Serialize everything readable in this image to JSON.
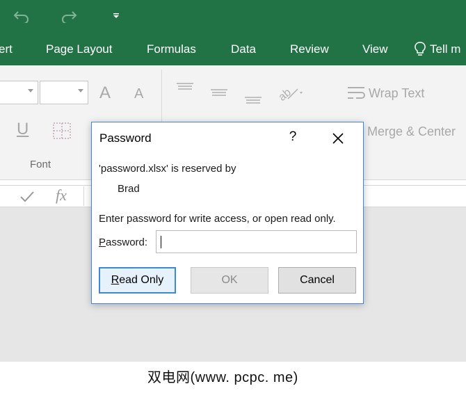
{
  "colors": {
    "excel_green": "#217346",
    "dialog_border": "#3f87d4",
    "sheet_gray": "#e6e6e6"
  },
  "quick_access": {
    "icons": [
      "undo-icon",
      "redo-icon",
      "customize-qat-icon"
    ]
  },
  "ribbon_tabs": [
    {
      "label": "ert"
    },
    {
      "label": "Page Layout"
    },
    {
      "label": "Formulas"
    },
    {
      "label": "Data"
    },
    {
      "label": "Review"
    },
    {
      "label": "View"
    }
  ],
  "tell_me": {
    "label": "Tell m",
    "icon": "lightbulb-icon"
  },
  "ribbon": {
    "increase_font_glyph": "A",
    "decrease_font_glyph": "A",
    "underline_glyph": "U",
    "font_group_label": "Font",
    "wrap_text_label": "Wrap Text",
    "merge_center_label": "Merge & Center"
  },
  "formula_bar": {
    "fx_label": "fx"
  },
  "dialog": {
    "title": "Password",
    "help_label": "?",
    "reserved_line": "'password.xlsx' is reserved by",
    "reserved_by": "Brad",
    "instruction": "Enter password for write access, or open read only.",
    "password_label_mnemonic": "P",
    "password_label_rest": "assword:",
    "password_value": "",
    "read_only_mnemonic": "R",
    "read_only_rest": "ead Only",
    "ok_label": "OK",
    "cancel_label": "Cancel"
  },
  "watermark": "双电网(www. pcpc. me)"
}
